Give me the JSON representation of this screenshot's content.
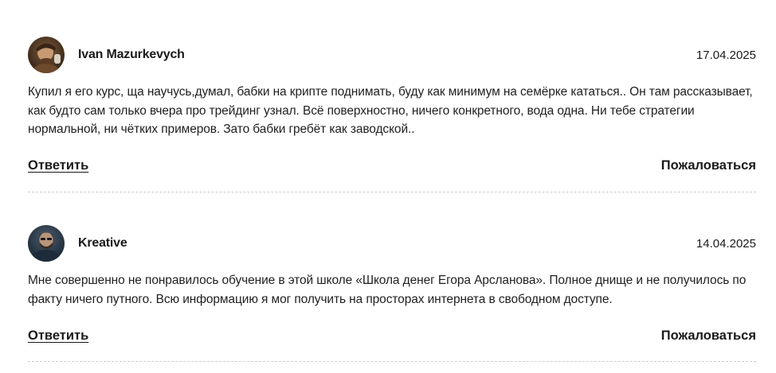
{
  "comments": [
    {
      "author": "Ivan Mazurkevych",
      "date": "17.04.2025",
      "text": "Купил я его курс, ща научусь,думал, бабки на крипте поднимать, буду как минимум на семёрке кататься.. Он там рассказывает, как будто сам только вчера про трейдинг узнал. Всё поверхностно, ничего конкретного, вода одна. Ни тебе стратегии нормальной, ни чётких примеров. Зато бабки гребёт как заводской..",
      "reply_label": "Ответить",
      "report_label": "Пожаловаться"
    },
    {
      "author": "Kreative",
      "date": "14.04.2025",
      "text": "Мне совершенно не понравилось обучение в этой школе «Школа денег Егора Арсланова». Полное днище и не получилось по факту ничего путного. Всю информацию я мог получить на просторах интернета в свободном доступе.",
      "reply_label": "Ответить",
      "report_label": "Пожаловаться"
    }
  ]
}
